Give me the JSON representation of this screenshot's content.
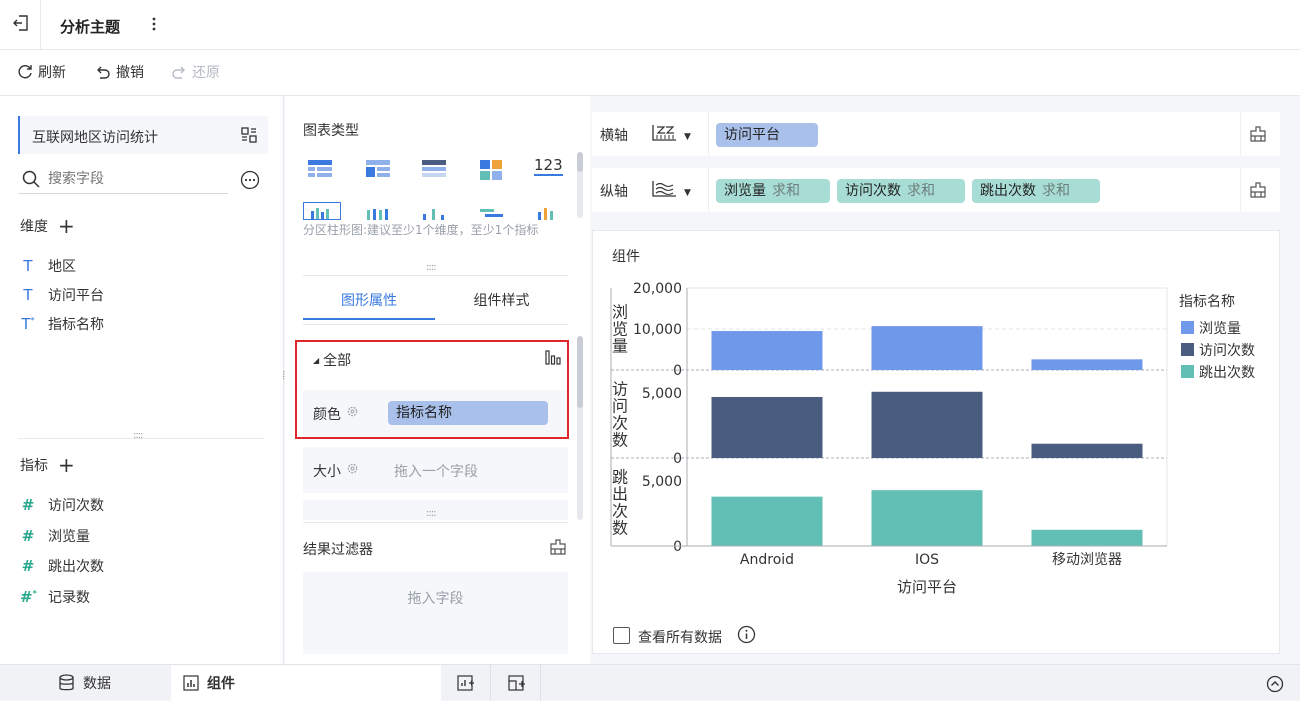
{
  "header": {
    "title": "分析主题",
    "back_icon": "exit-icon",
    "more_icon": "more-vertical-icon"
  },
  "toolbar": {
    "refresh_label": "刷新",
    "undo_label": "撤销",
    "redo_label": "还原"
  },
  "left_panel": {
    "dataset_name": "互联网地区访问统计",
    "search_placeholder": "搜索字段",
    "dimensions_title": "维度",
    "dimensions": [
      "地区",
      "访问平台",
      "指标名称"
    ],
    "metrics_title": "指标",
    "metrics": [
      "访问次数",
      "浏览量",
      "跳出次数",
      "记录数"
    ]
  },
  "mid_panel": {
    "chart_type_title": "图表类型",
    "chart_type_hint": "分区柱形图:建议至少1个维度，至少1个指标",
    "number_icon_label": "123",
    "tabs": [
      "图形属性",
      "组件样式"
    ],
    "group_label": "全部",
    "color_label": "颜色",
    "color_field": "指标名称",
    "size_label": "大小",
    "size_placeholder": "拖入一个字段",
    "filter_title": "结果过滤器",
    "filter_placeholder": "拖入字段"
  },
  "axes": {
    "x_label": "横轴",
    "x_fields": [
      {
        "name": "访问平台"
      }
    ],
    "y_label": "纵轴",
    "y_fields": [
      {
        "name": "浏览量",
        "agg": "求和"
      },
      {
        "name": "访问次数",
        "agg": "求和"
      },
      {
        "name": "跳出次数",
        "agg": "求和"
      }
    ]
  },
  "chart_panel": {
    "title": "组件",
    "show_all_label": "查看所有数据"
  },
  "chart_data": {
    "type": "bar",
    "categories": [
      "Android",
      "IOS",
      "移动浏览器"
    ],
    "xlabel": "访问平台",
    "legend_title": "指标名称",
    "legend_position": "right",
    "series": [
      {
        "name": "浏览量",
        "values": [
          9500,
          10700,
          2600
        ],
        "ylim": [
          0,
          20000
        ],
        "ticks": [
          "20,000",
          "10,000",
          "0"
        ],
        "color": "#6f97ea",
        "ylabel": "浏览量"
      },
      {
        "name": "访问次数",
        "values": [
          4700,
          5100,
          1100
        ],
        "ylim": [
          0,
          6700
        ],
        "ticks": [
          "5,000",
          "0"
        ],
        "color": "#4a5d80",
        "ylabel": "访问次数"
      },
      {
        "name": "跳出次数",
        "values": [
          3800,
          4300,
          1250
        ],
        "ylim": [
          0,
          6700
        ],
        "ticks": [
          "5,000",
          "0"
        ],
        "color": "#62bfb5",
        "ylabel": "跳出次数"
      }
    ]
  },
  "bottom_tabs": {
    "data_label": "数据",
    "component_label": "组件"
  }
}
